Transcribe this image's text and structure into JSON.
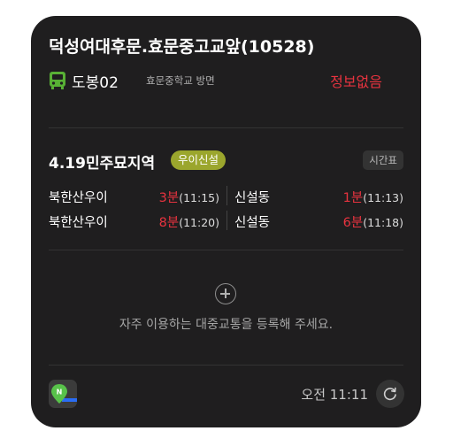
{
  "stop": {
    "name": "덕성여대후문.효문중고교앞(10528)"
  },
  "route": {
    "number": "도봉02",
    "direction": "효문중학교 방면",
    "status": "정보없음"
  },
  "line": {
    "name": "4.19민주묘지역",
    "badge": "우이신설",
    "timetable_label": "시간표",
    "arrivals": [
      {
        "left": {
          "destination": "북한산우이",
          "minutes": "3분",
          "time": "(11:15)"
        },
        "right": {
          "destination": "신설동",
          "minutes": "1분",
          "time": "(11:13)"
        }
      },
      {
        "left": {
          "destination": "북한산우이",
          "minutes": "8분",
          "time": "(11:20)"
        },
        "right": {
          "destination": "신설동",
          "minutes": "6분",
          "time": "(11:18)"
        }
      }
    ]
  },
  "add_transit": {
    "text": "자주 이용하는 대중교통을 등록해 주세요."
  },
  "footer": {
    "updated_time": "오전 11:11"
  },
  "icons": {
    "bus": "bus-icon",
    "add": "plus-circle-icon",
    "app": "naver-map-icon",
    "refresh": "refresh-icon"
  },
  "colors": {
    "background": "#1f1e1f",
    "bus_green": "#58b035",
    "alert_red": "#e8333f",
    "line_badge": "#9ba62d"
  }
}
